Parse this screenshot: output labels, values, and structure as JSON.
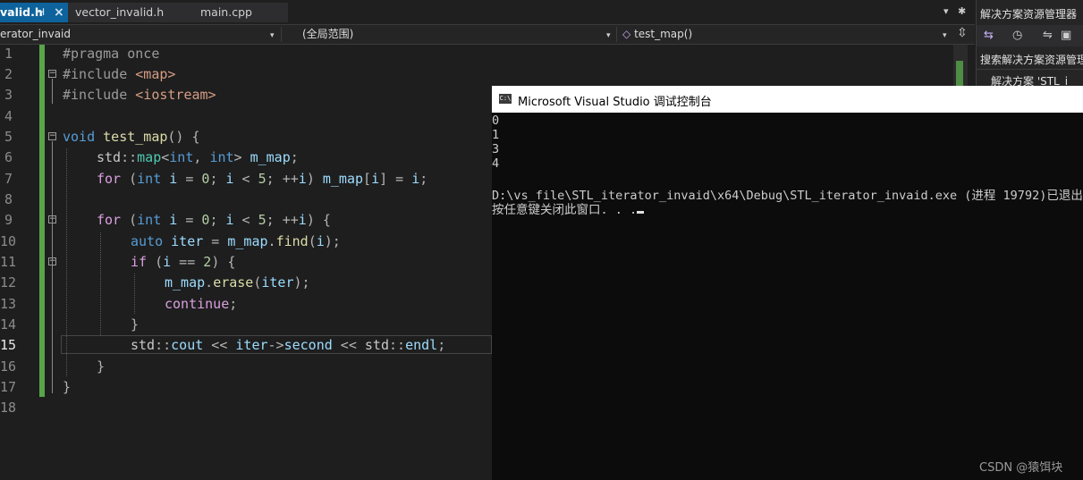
{
  "tabs": [
    {
      "label": "valid.h",
      "active": true,
      "pin": "⊣",
      "close": "×"
    },
    {
      "label": "vector_invalid.h",
      "active": false
    },
    {
      "label": "main.cpp",
      "active": false
    }
  ],
  "tab_controls": {
    "dropdown": "▾",
    "settings": "✱"
  },
  "navbar": {
    "project": "erator_invaid",
    "scope": "(全局范围)",
    "function_icon": "◇",
    "function": "test_map()",
    "arrow": "▾",
    "split": "⇳"
  },
  "line_numbers": [
    "1",
    "2",
    "3",
    "4",
    "5",
    "6",
    "7",
    "8",
    "9",
    "10",
    "11",
    "12",
    "13",
    "14",
    "15",
    "16",
    "17",
    "18"
  ],
  "code": {
    "l1": "#pragma once",
    "l2a": "#include ",
    "l2b": "<map>",
    "l3a": "#include ",
    "l3b": "<iostream>",
    "l5a": "void",
    "l5b": " ",
    "l5c": "test_map",
    "l5d": "() {",
    "l6a": "std",
    "l6b": "::",
    "l6c": "map",
    "l6d": "<",
    "l6e": "int",
    "l6f": ", ",
    "l6g": "int",
    "l6h": "> ",
    "l6i": "m_map",
    "l6j": ";",
    "l7a": "for",
    "l7b": " (",
    "l7c": "int",
    "l7d": " ",
    "l7e": "i",
    "l7f": " = ",
    "l7g": "0",
    "l7h": "; ",
    "l7i": "i",
    "l7j": " < ",
    "l7k": "5",
    "l7l": "; ++",
    "l7m": "i",
    "l7n": ") ",
    "l7o": "m_map",
    "l7p": "[",
    "l7q": "i",
    "l7r": "] = ",
    "l7s": "i",
    "l7t": ";",
    "l9a": "for",
    "l9b": " (",
    "l9c": "int",
    "l9d": " ",
    "l9e": "i",
    "l9f": " = ",
    "l9g": "0",
    "l9h": "; ",
    "l9i": "i",
    "l9j": " < ",
    "l9k": "5",
    "l9l": "; ++",
    "l9m": "i",
    "l9n": ") {",
    "l10a": "auto",
    "l10b": " ",
    "l10c": "iter",
    "l10d": " = ",
    "l10e": "m_map",
    "l10f": ".",
    "l10g": "find",
    "l10h": "(",
    "l10i": "i",
    "l10j": ");",
    "l11a": "if",
    "l11b": " (",
    "l11c": "i",
    "l11d": " == ",
    "l11e": "2",
    "l11f": ") {",
    "l12a": "m_map",
    "l12b": ".",
    "l12c": "erase",
    "l12d": "(",
    "l12e": "iter",
    "l12f": ");",
    "l13a": "continue",
    "l13b": ";",
    "l14": "}",
    "l15a": "std",
    "l15b": "::",
    "l15c": "cout",
    "l15d": " << ",
    "l15e": "iter",
    "l15f": "->",
    "l15g": "second",
    "l15h": " << ",
    "l15i": "std",
    "l15j": "::",
    "l15k": "endl",
    "l15l": ";",
    "l16": "}",
    "l17": "}"
  },
  "fold_marker": "−",
  "solution_explorer": {
    "title": "解决方案资源管理器",
    "search": "搜索解决方案资源管理",
    "solution_item": "解决方案 'STL_i"
  },
  "console": {
    "icon_text": "C:\\",
    "title": "Microsoft Visual Studio 调试控制台",
    "lines": [
      "0",
      "1",
      "3",
      "4",
      "",
      "D:\\vs_file\\STL_iterator_invaid\\x64\\Debug\\STL_iterator_invaid.exe (进程 19792)已退出",
      "按任意键关闭此窗口. . ."
    ]
  },
  "watermark": "CSDN @猿饵块",
  "colors": {
    "active_tab": "#0e639c",
    "change_bar": "#57a64a",
    "console_bg": "#0c0c0c"
  }
}
